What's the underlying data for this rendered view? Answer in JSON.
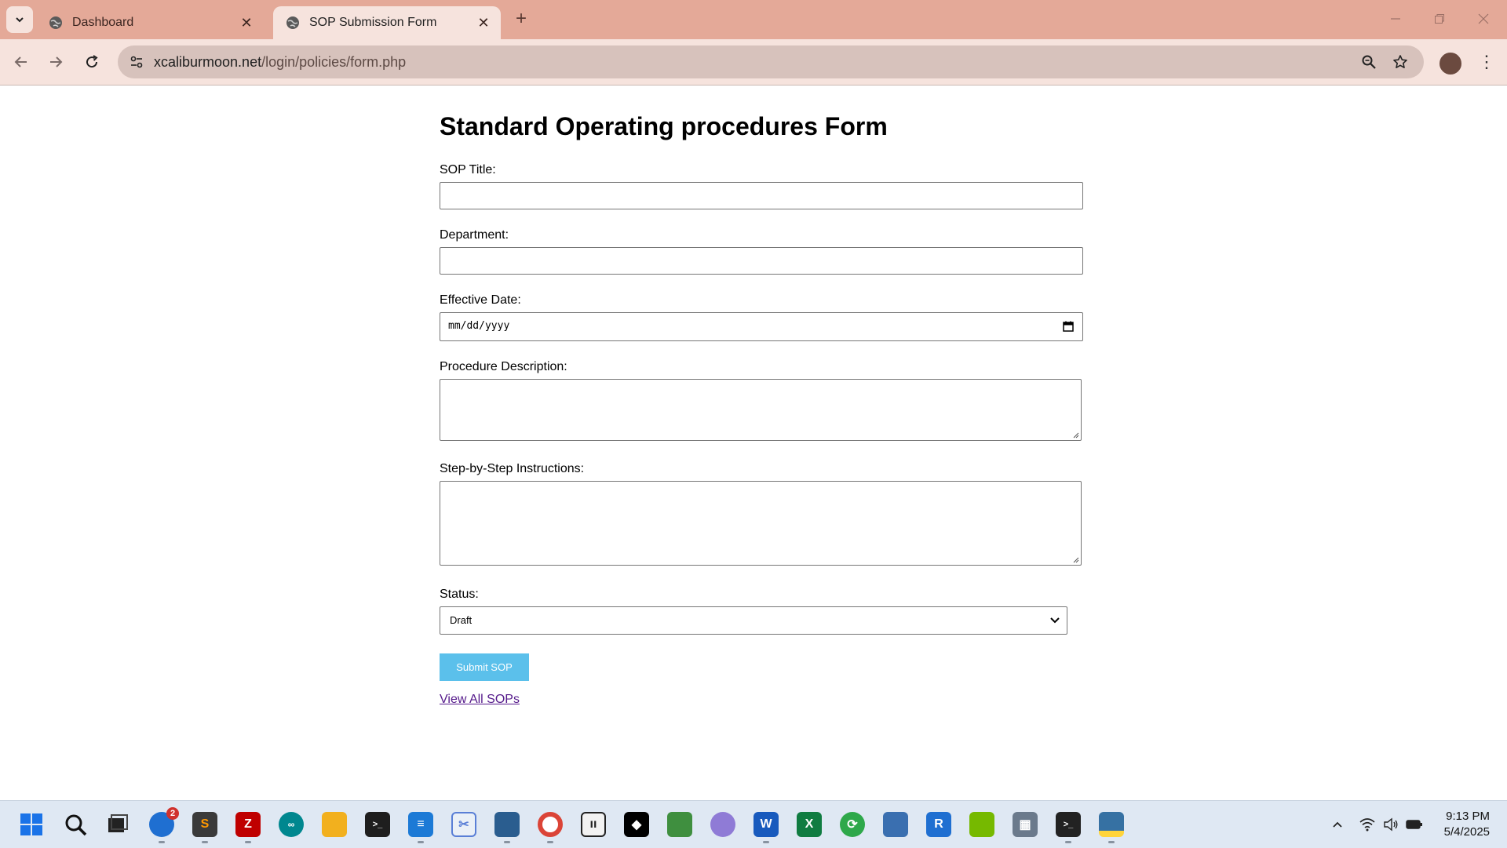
{
  "browser": {
    "tabs": [
      {
        "title": "Dashboard",
        "active": false
      },
      {
        "title": "SOP Submission Form",
        "active": true
      }
    ],
    "address": {
      "host": "xcaliburmoon.net",
      "path": "/login/policies/form.php"
    },
    "colors": {
      "tabstrip": "#e4a998",
      "toolbar": "#f6e3dd",
      "omnibox": "#d7c2bc"
    }
  },
  "page": {
    "heading": "Standard Operating procedures Form",
    "fields": {
      "title_label": "SOP Title:",
      "department_label": "Department:",
      "date_label": "Effective Date:",
      "date_placeholder": "mm/dd/yyyy",
      "description_label": "Procedure Description:",
      "instructions_label": "Step-by-Step Instructions:",
      "status_label": "Status:",
      "status_selected": "Draft"
    },
    "submit_label": "Submit SOP",
    "view_all_link": "View All SOPs",
    "colors": {
      "submit_button": "#5bc0eb",
      "link": "#551a8b"
    }
  },
  "taskbar": {
    "apps": [
      "start-icon",
      "search-icon",
      "task-view-icon",
      "thunderbird-icon",
      "sublime-text-icon",
      "filezilla-icon",
      "arduino-icon",
      "file-explorer-icon",
      "terminal-icon",
      "notepad-icon",
      "snipping-tool-icon",
      "mysql-workbench-icon",
      "chrome-icon",
      "twitch-icon",
      "capcut-icon",
      "inkscape-icon",
      "copilot-icon",
      "word-icon",
      "excel-icon",
      "edge-sync-icon",
      "network-icon",
      "rstudio-icon",
      "nvidia-icon",
      "calculator-icon",
      "powershell-icon",
      "python-icon"
    ],
    "badge_count": "2",
    "clock_time": "9:13 PM",
    "clock_date": "5/4/2025"
  }
}
